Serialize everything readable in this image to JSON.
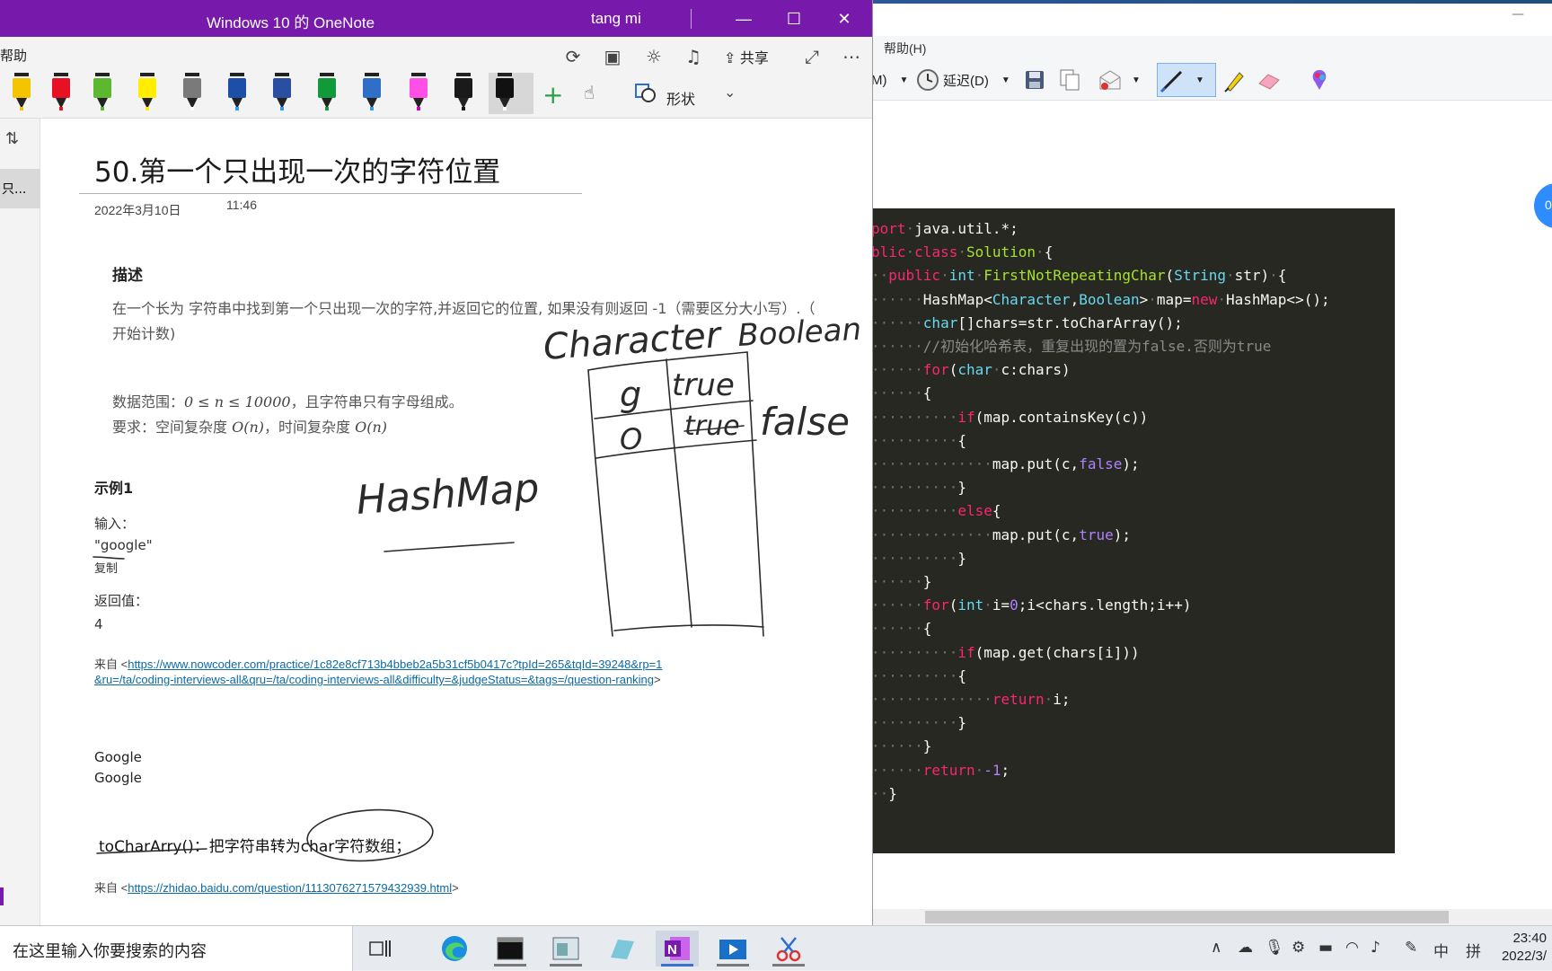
{
  "snip_window": {
    "menu_help": "帮助(H)",
    "minimize": "—",
    "delay_label": "延迟(D)",
    "mode_fragment": "M)",
    "bubble_text": "0"
  },
  "code": {
    "lines": [
      [
        [
          "kw",
          "port"
        ],
        [
          "dot",
          "·"
        ],
        [
          "pl",
          "java.util.*;"
        ]
      ],
      [
        [
          "kw",
          "blic"
        ],
        [
          "dot",
          "·"
        ],
        [
          "kw",
          "class"
        ],
        [
          "dot",
          "·"
        ],
        [
          "fn",
          "Solution"
        ],
        [
          "dot",
          "·"
        ],
        [
          "pl",
          "{"
        ]
      ],
      [
        [
          "dot",
          "··"
        ],
        [
          "kw",
          "public"
        ],
        [
          "dot",
          "·"
        ],
        [
          "ty",
          "int"
        ],
        [
          "dot",
          "·"
        ],
        [
          "fn",
          "FirstNotRepeatingChar"
        ],
        [
          "pl",
          "("
        ],
        [
          "ty",
          "String"
        ],
        [
          "dot",
          "·"
        ],
        [
          "pl",
          "str)"
        ],
        [
          "dot",
          "·"
        ],
        [
          "pl",
          "{"
        ]
      ],
      [
        [
          "dot",
          "······"
        ],
        [
          "pl",
          "HashMap<"
        ],
        [
          "ty",
          "Character"
        ],
        [
          "pl",
          ","
        ],
        [
          "ty",
          "Boolean"
        ],
        [
          "pl",
          ">"
        ],
        [
          "dot",
          "·"
        ],
        [
          "pl",
          "map="
        ],
        [
          "kw",
          "new"
        ],
        [
          "dot",
          "·"
        ],
        [
          "pl",
          "HashMap<>();"
        ]
      ],
      [
        [
          "dot",
          "······"
        ],
        [
          "ty",
          "char"
        ],
        [
          "pl",
          "[]chars=str.toCharArray();"
        ]
      ],
      [
        [
          "dot",
          "······"
        ],
        [
          "cm",
          "//初始化哈希表，重复出现的置为false.否则为true"
        ]
      ],
      [
        [
          "dot",
          "······"
        ],
        [
          "kw",
          "for"
        ],
        [
          "pl",
          "("
        ],
        [
          "ty",
          "char"
        ],
        [
          "dot",
          "·"
        ],
        [
          "pl",
          "c:chars)"
        ]
      ],
      [
        [
          "dot",
          "······"
        ],
        [
          "pl",
          "{"
        ]
      ],
      [
        [
          "dot",
          "··········"
        ],
        [
          "kw",
          "if"
        ],
        [
          "pl",
          "(map.containsKey(c))"
        ]
      ],
      [
        [
          "dot",
          "··········"
        ],
        [
          "pl",
          "{"
        ]
      ],
      [
        [
          "dot",
          "··············"
        ],
        [
          "pl",
          "map.put(c,"
        ],
        [
          "nm",
          "false"
        ],
        [
          "pl",
          ");"
        ]
      ],
      [
        [
          "dot",
          "··········"
        ],
        [
          "pl",
          "}"
        ]
      ],
      [
        [
          "dot",
          "··········"
        ],
        [
          "kw",
          "else"
        ],
        [
          "pl",
          "{"
        ]
      ],
      [
        [
          "dot",
          "··············"
        ],
        [
          "pl",
          "map.put(c,"
        ],
        [
          "nm",
          "true"
        ],
        [
          "pl",
          ");"
        ]
      ],
      [
        [
          "dot",
          "··········"
        ],
        [
          "pl",
          "}"
        ]
      ],
      [
        [
          "dot",
          "······"
        ],
        [
          "pl",
          "}"
        ]
      ],
      [
        [
          "dot",
          "······"
        ],
        [
          "kw",
          "for"
        ],
        [
          "pl",
          "("
        ],
        [
          "ty",
          "int"
        ],
        [
          "dot",
          "·"
        ],
        [
          "pl",
          "i="
        ],
        [
          "nm",
          "0"
        ],
        [
          "pl",
          ";i<chars.length;i++)"
        ]
      ],
      [
        [
          "dot",
          "······"
        ],
        [
          "pl",
          "{"
        ]
      ],
      [
        [
          "dot",
          "··········"
        ],
        [
          "kw",
          "if"
        ],
        [
          "pl",
          "(map.get(chars[i]))"
        ]
      ],
      [
        [
          "dot",
          "··········"
        ],
        [
          "pl",
          "{"
        ]
      ],
      [
        [
          "dot",
          "··············"
        ],
        [
          "kw",
          "return"
        ],
        [
          "dot",
          "·"
        ],
        [
          "pl",
          "i;"
        ]
      ],
      [
        [
          "dot",
          "··········"
        ],
        [
          "pl",
          "}"
        ]
      ],
      [
        [
          "dot",
          "······"
        ],
        [
          "pl",
          "}"
        ]
      ],
      [
        [
          "dot",
          "······"
        ],
        [
          "kw",
          "return"
        ],
        [
          "dot",
          "·"
        ],
        [
          "nm",
          "-1"
        ],
        [
          "pl",
          ";"
        ]
      ],
      [
        [
          "dot",
          "··"
        ],
        [
          "pl",
          "}"
        ]
      ]
    ]
  },
  "onenote": {
    "title": "Windows 10 的 OneNote",
    "user": "tang mi",
    "help_menu": "帮助",
    "share_label": "共享",
    "shapes_label": "形状",
    "page_item": "只...",
    "accent": "#7719aa",
    "pens": [
      {
        "color": "#f5c400",
        "nib": "#f5c400"
      },
      {
        "color": "#e81123",
        "nib": "#e81123"
      },
      {
        "color": "#5cb82e",
        "nib": "#5cb82e"
      },
      {
        "color": "#ffee00",
        "nib": "#ffee00"
      },
      {
        "color": "#7a7a7a",
        "nib": "#ffffff"
      },
      {
        "color": "#1e4fa8",
        "nib": "#2a9df4"
      },
      {
        "color": "#2a4ea0",
        "nib": "#2a9df4"
      },
      {
        "color": "#109a3a",
        "nib": "#109a3a"
      },
      {
        "color": "#2f6fc7",
        "nib": "#2a9df4"
      },
      {
        "color": "#ff4fe6",
        "nib": "#cc00cc"
      },
      {
        "color": "#1a1a1a",
        "nib": "#1a1a1a"
      },
      {
        "color": "#111111",
        "nib": "#ffffff"
      }
    ],
    "page": {
      "title": "50.第一个只出现一次的字符位置",
      "date": "2022年3月10日",
      "time": "11:46",
      "desc_heading": "描述",
      "desc_line1": "在一个长为 字符串中找到第一个只出现一次的字符,并返回它的位置, 如果没有则返回 -1（需要区分大小写）.（",
      "desc_line2": "开始计数)",
      "range_prefix": "数据范围：",
      "range_math": "0 ≤ n ≤ 10000",
      "range_suffix": "，且字符串只有字母组成。",
      "req_prefix": "要求：空间复杂度 ",
      "req_math1": "O(n)",
      "req_mid": "，时间复杂度 ",
      "req_math2": "O(n)",
      "example_heading": "示例1",
      "input_label": "输入：",
      "input_value": "\"google\"",
      "copy_label": "复制",
      "return_label": "返回值：",
      "return_value": "4",
      "source_prefix": "来自 <",
      "source_link1_a": "https://www.nowcoder.com/practice/1c82e8cf713b4bbeb2a5b31cf5b0417c?tpId=265&tqId=39248&rp=1",
      "source_link1_b": "&ru=/ta/coding-interviews-all&qru=/ta/coding-interviews-all&difficulty=&judgeStatus=&tags=/question-ranking",
      "source_suffix": ">",
      "google1": "Google",
      "google2": "Google",
      "tochar_label": "toCharArry()",
      "tochar_desc": "：把字符串转为char字符数组；",
      "source2_prefix": "来自 <",
      "source_link2": "https://zhidao.baidu.com/question/1113076271579432939.html",
      "source2_suffix": ">"
    },
    "ink": {
      "character": "Character",
      "boolean": "Boolean",
      "g": "g",
      "true1": "true",
      "o": "O",
      "true2": "true",
      "false": "false",
      "hashmap": "HashMap"
    }
  },
  "taskbar": {
    "search_placeholder": "在这里输入你要搜索的内容",
    "ime_lang": "中",
    "ime_mode": "拼",
    "time": "23:40",
    "date": "2022/3/"
  }
}
